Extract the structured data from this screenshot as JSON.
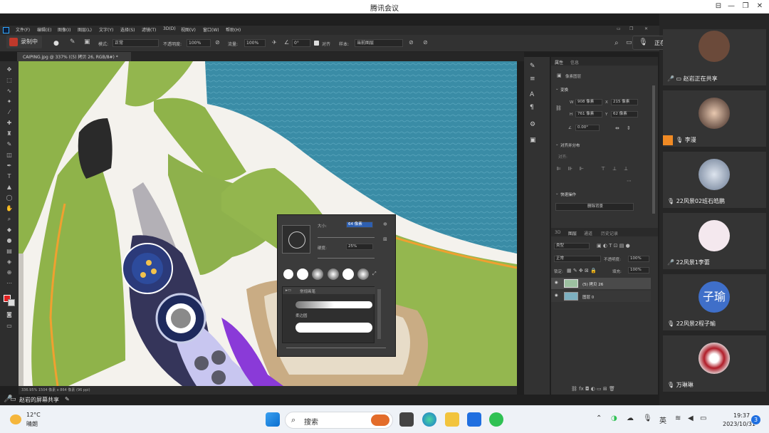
{
  "window": {
    "title": "腾讯会议"
  },
  "ps": {
    "menu": [
      "文件(F)",
      "编辑(E)",
      "图像(I)",
      "图层(L)",
      "文字(Y)",
      "选择(S)",
      "滤镜(T)",
      "3D(D)",
      "视图(V)",
      "窗口(W)",
      "帮助(H)"
    ],
    "recording_label": "录制中",
    "options": {
      "mode_label": "模式:",
      "mode_value": "正常",
      "opacity_label": "不透明度:",
      "opacity_value": "100%",
      "flow_label": "流量:",
      "flow_value": "100%",
      "angle_value": "0°",
      "align_label": "对齐",
      "sample_label": "样本:",
      "sample_value": "当前图层"
    },
    "doc_tab": "CAIPING.jpg @ 337% ((5) 拷贝 26, RGB/8#) *",
    "status": "336.95%   1504 像素 x 864 像素 (96 ppi)",
    "properties": {
      "tab_props": "属性",
      "tab_info": "信息",
      "pixel_layer": "像素图层",
      "transform": "变换",
      "w": "908 像素",
      "x": "215 像素",
      "h": "761 像素",
      "y": "62 像素",
      "angle": "0.00°",
      "align_dist": "对齐并分布",
      "align": "对齐:",
      "quick_actions": "快速操作",
      "remove_bg": "删除背景"
    },
    "layers": {
      "tabs": [
        "3D",
        "图层",
        "通道",
        "历史记录"
      ],
      "kind": "类型",
      "blend": "正常",
      "opacity_label": "不透明度:",
      "opacity": "100%",
      "lock": "锁定:",
      "fill_label": "填充:",
      "fill": "100%",
      "items": [
        "(5) 拷贝 26",
        "图层 0"
      ]
    },
    "brush": {
      "size_label": "大小:",
      "size_value": "64 像素",
      "hardness_label": "硬度:",
      "hardness_value": "25%",
      "group": "常规画笔",
      "brush1": "柔边圆"
    }
  },
  "share_bar": "赵岩的屏幕共享",
  "speaking": "正在讲话:",
  "participants": [
    {
      "name": "赵岩正在共享",
      "mic": "on"
    },
    {
      "name": "李漫",
      "mic": "off"
    },
    {
      "name": "22风景02班石皓鹏",
      "mic": "off"
    },
    {
      "name": "22风景1李蕾",
      "mic": "on"
    },
    {
      "name": "22风景2程子瑜",
      "mic": "off",
      "avatar_text": "子瑜"
    },
    {
      "name": "万琳琳",
      "mic": "off"
    }
  ],
  "taskbar": {
    "temp": "12°C",
    "weather": "晴朗",
    "search": "搜索",
    "ime": "英",
    "time": "19:37",
    "date": "2023/10/31",
    "badge": "3"
  },
  "colors": {
    "water": "#3a8ca6",
    "grass": "#8fb34a",
    "road": "#ffffff",
    "accent_orange": "#f0a030",
    "purple": "#8a3ad8"
  }
}
